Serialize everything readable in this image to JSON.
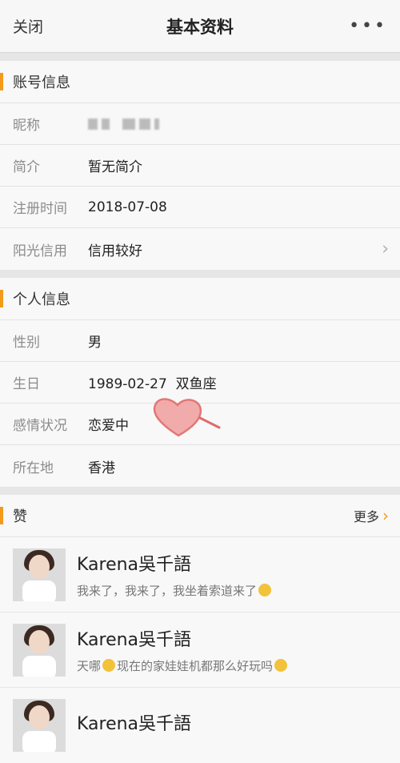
{
  "nav": {
    "close_label": "关闭",
    "title": "基本资料",
    "more_label": "•••"
  },
  "account": {
    "title": "账号信息",
    "rows": [
      {
        "label": "昵称",
        "value": ""
      },
      {
        "label": "简介",
        "value": "暂无简介"
      },
      {
        "label": "注册时间",
        "value": "2018-07-08"
      },
      {
        "label": "阳光信用",
        "value": "信用较好"
      }
    ]
  },
  "personal": {
    "title": "个人信息",
    "rows": [
      {
        "label": "性别",
        "value": "男"
      },
      {
        "label": "生日",
        "value": "1989-02-27  双鱼座"
      },
      {
        "label": "感情状况",
        "value": "恋爱中"
      },
      {
        "label": "所在地",
        "value": "香港"
      }
    ]
  },
  "likes": {
    "title": "赞",
    "more_label": "更多",
    "items": [
      {
        "name": "Karena吳千語",
        "message": "我来了，我来了，我坐着索道来了"
      },
      {
        "name": "Karena吳千語",
        "message_a": "天哪",
        "message_b": "现在的家娃娃机都那么好玩吗"
      },
      {
        "name": "Karena吳千語",
        "message": ""
      }
    ]
  },
  "colors": {
    "accent": "#f39a1b",
    "heart": "#e87a7a"
  }
}
